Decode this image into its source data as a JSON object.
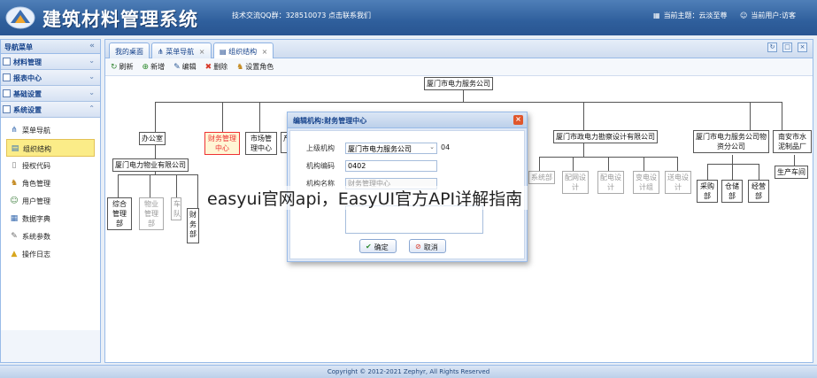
{
  "header": {
    "title": "建筑材料管理系统",
    "qq_text": "技术交流QQ群：328510073 点击联系我们",
    "current_theme": "当前主题：云淡至尊",
    "current_user": "当前用户:访客"
  },
  "sidebar": {
    "title": "导航菜单",
    "groups": [
      {
        "label": "材料管理"
      },
      {
        "label": "报表中心"
      },
      {
        "label": "基础设置"
      },
      {
        "label": "系统设置"
      }
    ],
    "items": [
      {
        "label": "菜单导航",
        "icon": "tree-icon"
      },
      {
        "label": "组织结构",
        "icon": "org-icon"
      },
      {
        "label": "授权代码",
        "icon": "doc-icon"
      },
      {
        "label": "角色管理",
        "icon": "role-icon"
      },
      {
        "label": "用户管理",
        "icon": "user-icon"
      },
      {
        "label": "数据字典",
        "icon": "dict-icon"
      },
      {
        "label": "系统参数",
        "icon": "param-icon"
      },
      {
        "label": "操作日志",
        "icon": "warn-icon"
      }
    ]
  },
  "tabs": [
    {
      "label": "我的桌面"
    },
    {
      "label": "菜单导航"
    },
    {
      "label": "组织结构"
    }
  ],
  "toolbar": {
    "refresh": "刷新",
    "add": "新增",
    "edit": "编辑",
    "delete": "删除",
    "set_role": "设置角色"
  },
  "org": {
    "root": "厦门市电力服务公司",
    "office": "办公室",
    "finance": "财务管理中心",
    "market": "市场管理中心",
    "p_partial": "产",
    "survey": "厦门市政电力勘察设计有限公司",
    "service": "厦门市电力服务公司物资分公司",
    "cement": "南安市水泥制品厂",
    "property": "厦门电力物业有限公司",
    "comp_mgmt": "综合管理部",
    "prop_mgmt": "物业管理部",
    "car": "车队",
    "finance_dept": "财务部",
    "sys1": "系统部",
    "sys2": "配网设计",
    "sys3": "配电设计",
    "sys4": "变电设计组",
    "sys5": "送电设计",
    "purchase": "采购部",
    "warehouse": "仓储部",
    "operation": "经营部",
    "production": "生产车间"
  },
  "dialog": {
    "title": "编辑机构:财务管理中心",
    "parent_label": "上级机构",
    "parent_value": "厦门市电力服务公司",
    "parent_code": "04",
    "code_label": "机构编码",
    "code_value": "0402",
    "name_label": "机构名称",
    "name_value": "财务管理中心",
    "ok": "确定",
    "cancel": "取消"
  },
  "watermark": "easyui官网api，EasyUI官方API详解指南",
  "footer": "Copyright © 2012-2021 Zephyr, All Rights Reserved"
}
